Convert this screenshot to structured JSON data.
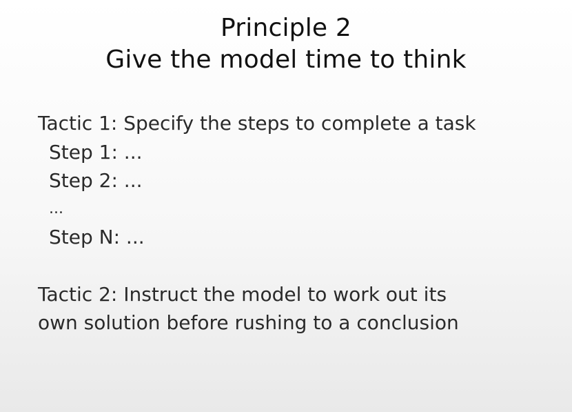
{
  "slide": {
    "title_line1": "Principle 2",
    "title_line2": "Give the model time to think",
    "tactic1": {
      "heading": "Tactic 1: Specify the steps to complete a task",
      "steps": [
        "Step 1: ...",
        "Step 2: ...",
        "...",
        "Step N: ..."
      ]
    },
    "tactic2": {
      "line1": "Tactic 2: Instruct the model to work out its",
      "line2": "own solution before rushing to a conclusion"
    }
  }
}
